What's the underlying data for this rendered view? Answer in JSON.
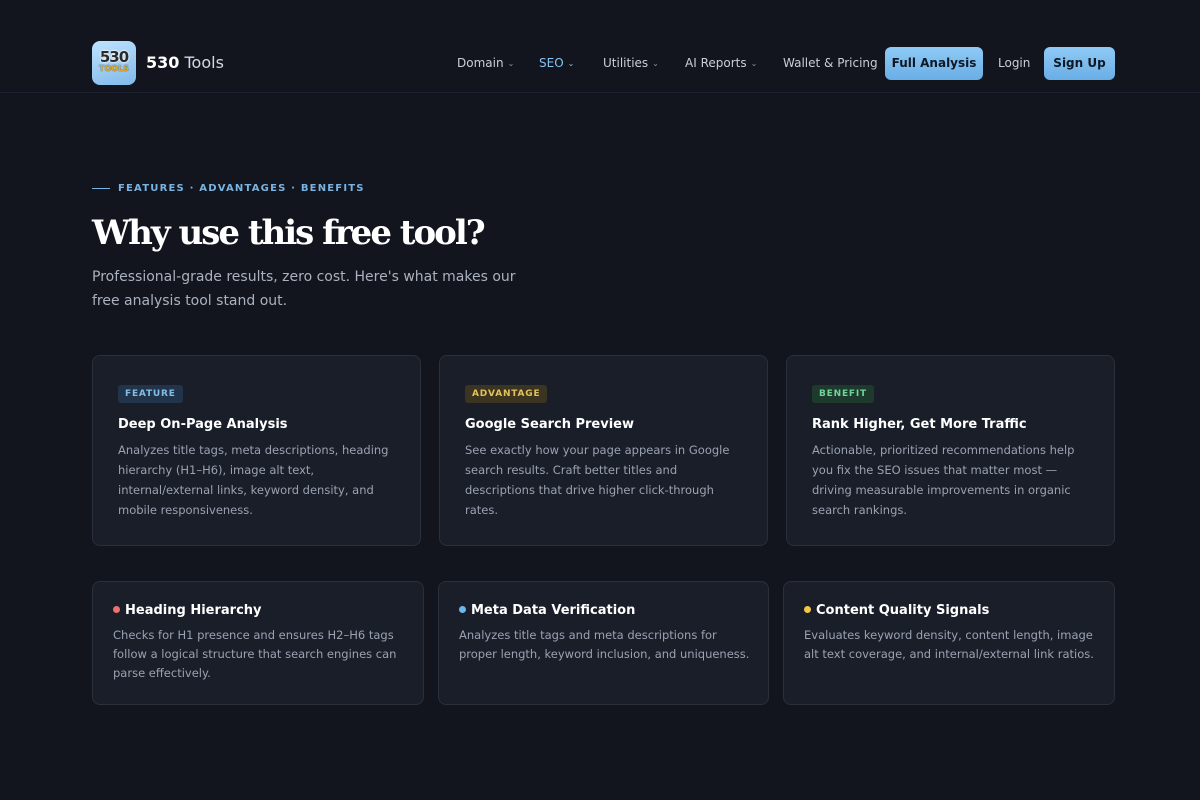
{
  "brand": {
    "logo_line1": "530",
    "logo_line2": "TOOLS",
    "name_num": "530",
    "name_rest": " Tools"
  },
  "nav": {
    "domain": "Domain",
    "seo": "SEO",
    "utilities": "Utilities",
    "ai_reports": "AI Reports",
    "wallet": "Wallet & Pricing",
    "full_analysis": "Full Analysis",
    "login": "Login",
    "signup": "Sign Up",
    "caret": "⌄"
  },
  "hero": {
    "eyebrow": "FEATURES · ADVANTAGES · BENEFITS",
    "title": "Why use this free tool?",
    "subtitle": "Professional-grade results, zero cost. Here's what makes our free analysis tool stand out."
  },
  "cards": [
    {
      "badge": "FEATURE",
      "title": "Deep On-Page Analysis",
      "text": "Analyzes title tags, meta descriptions, heading hierarchy (H1–H6), image alt text, internal/external links, keyword density, and mobile responsiveness."
    },
    {
      "badge": "ADVANTAGE",
      "title": "Google Search Preview",
      "text": "See exactly how your page appears in Google search results. Craft better titles and descriptions that drive higher click-through rates."
    },
    {
      "badge": "BENEFIT",
      "title": "Rank Higher, Get More Traffic",
      "text": "Actionable, prioritized recommendations help you fix the SEO issues that matter most — driving measurable improvements in organic search rankings."
    }
  ],
  "mini_cards": [
    {
      "title": "Heading Hierarchy",
      "text": "Checks for H1 presence and ensures H2–H6 tags follow a logical structure that search engines can parse effectively.",
      "dot_color": "#f0706a"
    },
    {
      "title": "Meta Data Verification",
      "text": "Analyzes title tags and meta descriptions for proper length, keyword inclusion, and uniqueness.",
      "dot_color": "#6cb6ee"
    },
    {
      "title": "Content Quality Signals",
      "text": "Evaluates keyword density, content length, image alt text coverage, and internal/external link ratios.",
      "dot_color": "#f2c744"
    }
  ],
  "colors": {
    "accent": "#7bbcef",
    "background": "#12151d",
    "card": "#1a1e28"
  }
}
